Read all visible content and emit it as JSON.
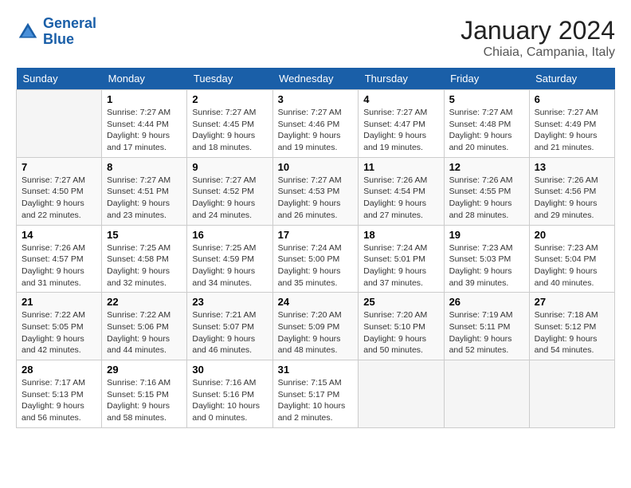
{
  "logo": {
    "line1": "General",
    "line2": "Blue"
  },
  "title": "January 2024",
  "subtitle": "Chiaia, Campania, Italy",
  "days_of_week": [
    "Sunday",
    "Monday",
    "Tuesday",
    "Wednesday",
    "Thursday",
    "Friday",
    "Saturday"
  ],
  "weeks": [
    [
      {
        "day": "",
        "sunrise": "",
        "sunset": "",
        "daylight": ""
      },
      {
        "day": "1",
        "sunrise": "Sunrise: 7:27 AM",
        "sunset": "Sunset: 4:44 PM",
        "daylight": "Daylight: 9 hours and 17 minutes."
      },
      {
        "day": "2",
        "sunrise": "Sunrise: 7:27 AM",
        "sunset": "Sunset: 4:45 PM",
        "daylight": "Daylight: 9 hours and 18 minutes."
      },
      {
        "day": "3",
        "sunrise": "Sunrise: 7:27 AM",
        "sunset": "Sunset: 4:46 PM",
        "daylight": "Daylight: 9 hours and 19 minutes."
      },
      {
        "day": "4",
        "sunrise": "Sunrise: 7:27 AM",
        "sunset": "Sunset: 4:47 PM",
        "daylight": "Daylight: 9 hours and 19 minutes."
      },
      {
        "day": "5",
        "sunrise": "Sunrise: 7:27 AM",
        "sunset": "Sunset: 4:48 PM",
        "daylight": "Daylight: 9 hours and 20 minutes."
      },
      {
        "day": "6",
        "sunrise": "Sunrise: 7:27 AM",
        "sunset": "Sunset: 4:49 PM",
        "daylight": "Daylight: 9 hours and 21 minutes."
      }
    ],
    [
      {
        "day": "7",
        "sunrise": "Sunrise: 7:27 AM",
        "sunset": "Sunset: 4:50 PM",
        "daylight": "Daylight: 9 hours and 22 minutes."
      },
      {
        "day": "8",
        "sunrise": "Sunrise: 7:27 AM",
        "sunset": "Sunset: 4:51 PM",
        "daylight": "Daylight: 9 hours and 23 minutes."
      },
      {
        "day": "9",
        "sunrise": "Sunrise: 7:27 AM",
        "sunset": "Sunset: 4:52 PM",
        "daylight": "Daylight: 9 hours and 24 minutes."
      },
      {
        "day": "10",
        "sunrise": "Sunrise: 7:27 AM",
        "sunset": "Sunset: 4:53 PM",
        "daylight": "Daylight: 9 hours and 26 minutes."
      },
      {
        "day": "11",
        "sunrise": "Sunrise: 7:26 AM",
        "sunset": "Sunset: 4:54 PM",
        "daylight": "Daylight: 9 hours and 27 minutes."
      },
      {
        "day": "12",
        "sunrise": "Sunrise: 7:26 AM",
        "sunset": "Sunset: 4:55 PM",
        "daylight": "Daylight: 9 hours and 28 minutes."
      },
      {
        "day": "13",
        "sunrise": "Sunrise: 7:26 AM",
        "sunset": "Sunset: 4:56 PM",
        "daylight": "Daylight: 9 hours and 29 minutes."
      }
    ],
    [
      {
        "day": "14",
        "sunrise": "Sunrise: 7:26 AM",
        "sunset": "Sunset: 4:57 PM",
        "daylight": "Daylight: 9 hours and 31 minutes."
      },
      {
        "day": "15",
        "sunrise": "Sunrise: 7:25 AM",
        "sunset": "Sunset: 4:58 PM",
        "daylight": "Daylight: 9 hours and 32 minutes."
      },
      {
        "day": "16",
        "sunrise": "Sunrise: 7:25 AM",
        "sunset": "Sunset: 4:59 PM",
        "daylight": "Daylight: 9 hours and 34 minutes."
      },
      {
        "day": "17",
        "sunrise": "Sunrise: 7:24 AM",
        "sunset": "Sunset: 5:00 PM",
        "daylight": "Daylight: 9 hours and 35 minutes."
      },
      {
        "day": "18",
        "sunrise": "Sunrise: 7:24 AM",
        "sunset": "Sunset: 5:01 PM",
        "daylight": "Daylight: 9 hours and 37 minutes."
      },
      {
        "day": "19",
        "sunrise": "Sunrise: 7:23 AM",
        "sunset": "Sunset: 5:03 PM",
        "daylight": "Daylight: 9 hours and 39 minutes."
      },
      {
        "day": "20",
        "sunrise": "Sunrise: 7:23 AM",
        "sunset": "Sunset: 5:04 PM",
        "daylight": "Daylight: 9 hours and 40 minutes."
      }
    ],
    [
      {
        "day": "21",
        "sunrise": "Sunrise: 7:22 AM",
        "sunset": "Sunset: 5:05 PM",
        "daylight": "Daylight: 9 hours and 42 minutes."
      },
      {
        "day": "22",
        "sunrise": "Sunrise: 7:22 AM",
        "sunset": "Sunset: 5:06 PM",
        "daylight": "Daylight: 9 hours and 44 minutes."
      },
      {
        "day": "23",
        "sunrise": "Sunrise: 7:21 AM",
        "sunset": "Sunset: 5:07 PM",
        "daylight": "Daylight: 9 hours and 46 minutes."
      },
      {
        "day": "24",
        "sunrise": "Sunrise: 7:20 AM",
        "sunset": "Sunset: 5:09 PM",
        "daylight": "Daylight: 9 hours and 48 minutes."
      },
      {
        "day": "25",
        "sunrise": "Sunrise: 7:20 AM",
        "sunset": "Sunset: 5:10 PM",
        "daylight": "Daylight: 9 hours and 50 minutes."
      },
      {
        "day": "26",
        "sunrise": "Sunrise: 7:19 AM",
        "sunset": "Sunset: 5:11 PM",
        "daylight": "Daylight: 9 hours and 52 minutes."
      },
      {
        "day": "27",
        "sunrise": "Sunrise: 7:18 AM",
        "sunset": "Sunset: 5:12 PM",
        "daylight": "Daylight: 9 hours and 54 minutes."
      }
    ],
    [
      {
        "day": "28",
        "sunrise": "Sunrise: 7:17 AM",
        "sunset": "Sunset: 5:13 PM",
        "daylight": "Daylight: 9 hours and 56 minutes."
      },
      {
        "day": "29",
        "sunrise": "Sunrise: 7:16 AM",
        "sunset": "Sunset: 5:15 PM",
        "daylight": "Daylight: 9 hours and 58 minutes."
      },
      {
        "day": "30",
        "sunrise": "Sunrise: 7:16 AM",
        "sunset": "Sunset: 5:16 PM",
        "daylight": "Daylight: 10 hours and 0 minutes."
      },
      {
        "day": "31",
        "sunrise": "Sunrise: 7:15 AM",
        "sunset": "Sunset: 5:17 PM",
        "daylight": "Daylight: 10 hours and 2 minutes."
      },
      {
        "day": "",
        "sunrise": "",
        "sunset": "",
        "daylight": ""
      },
      {
        "day": "",
        "sunrise": "",
        "sunset": "",
        "daylight": ""
      },
      {
        "day": "",
        "sunrise": "",
        "sunset": "",
        "daylight": ""
      }
    ]
  ]
}
